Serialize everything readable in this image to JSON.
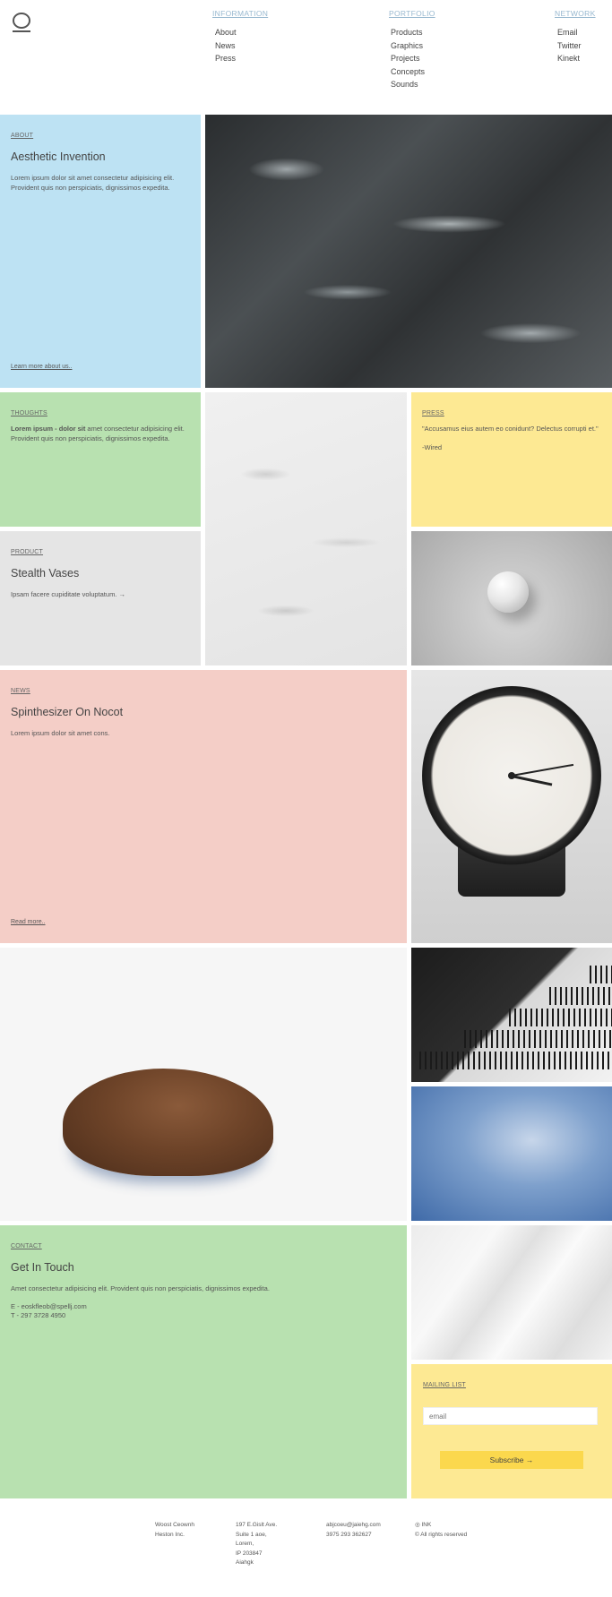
{
  "nav": {
    "columns": [
      {
        "heading": "INFORMATION",
        "items": [
          "About",
          "News",
          "Press"
        ]
      },
      {
        "heading": "PORTFOLIO",
        "items": [
          "Products",
          "Graphics",
          "Projects",
          "Concepts",
          "Sounds"
        ]
      },
      {
        "heading": "NETWORK",
        "items": [
          "Email",
          "Twitter",
          "Kinekt"
        ]
      }
    ]
  },
  "about": {
    "label": "ABOUT",
    "title": "Aesthetic Invention",
    "body": "Lorem ipsum dolor sit amet consectetur adipisicing elit. Provident quis non perspiciatis, dignissimos expedita.",
    "link": "Learn more about us.."
  },
  "thoughts": {
    "label": "THOUGHTS",
    "bold": "Lorem ipsum - dolor sit",
    "body": " amet consectetur adipisicing elit. Provident quis non perspiciatis, dignissimos expedita."
  },
  "press": {
    "label": "PRESS",
    "quote": "\"Accusamus eius autem eo conidunt? Delectus corrupti et.\"",
    "source": "-Wired"
  },
  "product": {
    "label": "PRODUCT",
    "title": "Stealth Vases",
    "body": "Ipsam facere cupiditate voluptatum. →"
  },
  "news": {
    "label": "NEWS",
    "title": "Spinthesizer On Nocot",
    "body": "Lorem ipsum dolor sit amet cons.",
    "link": "Read more.."
  },
  "contact": {
    "label": "CONTACT",
    "title": "Get In Touch",
    "body": "Amet consectetur adipisicing elit. Provident quis non perspiciatis, dignissimos expedita.",
    "email": "E - eoskfleob@spellj.com",
    "phone": "T - 297 3728 4950"
  },
  "mailing": {
    "label": "MAILING LIST",
    "placeholder": "email",
    "button": "Subscribe →"
  },
  "footer": {
    "col1": [
      "Woost Ceownh",
      "Heston Inc."
    ],
    "col2": [
      "197 E.Gislt Ave.",
      "Suite 1 aoe,",
      "Lorem,",
      "IP 203847",
      "Aiahgk"
    ],
    "col3": [
      "abjcoeu@jaiehg.com",
      "3975 293 362627"
    ],
    "col4": [
      "◎ INK",
      "© All rights reserved"
    ]
  }
}
